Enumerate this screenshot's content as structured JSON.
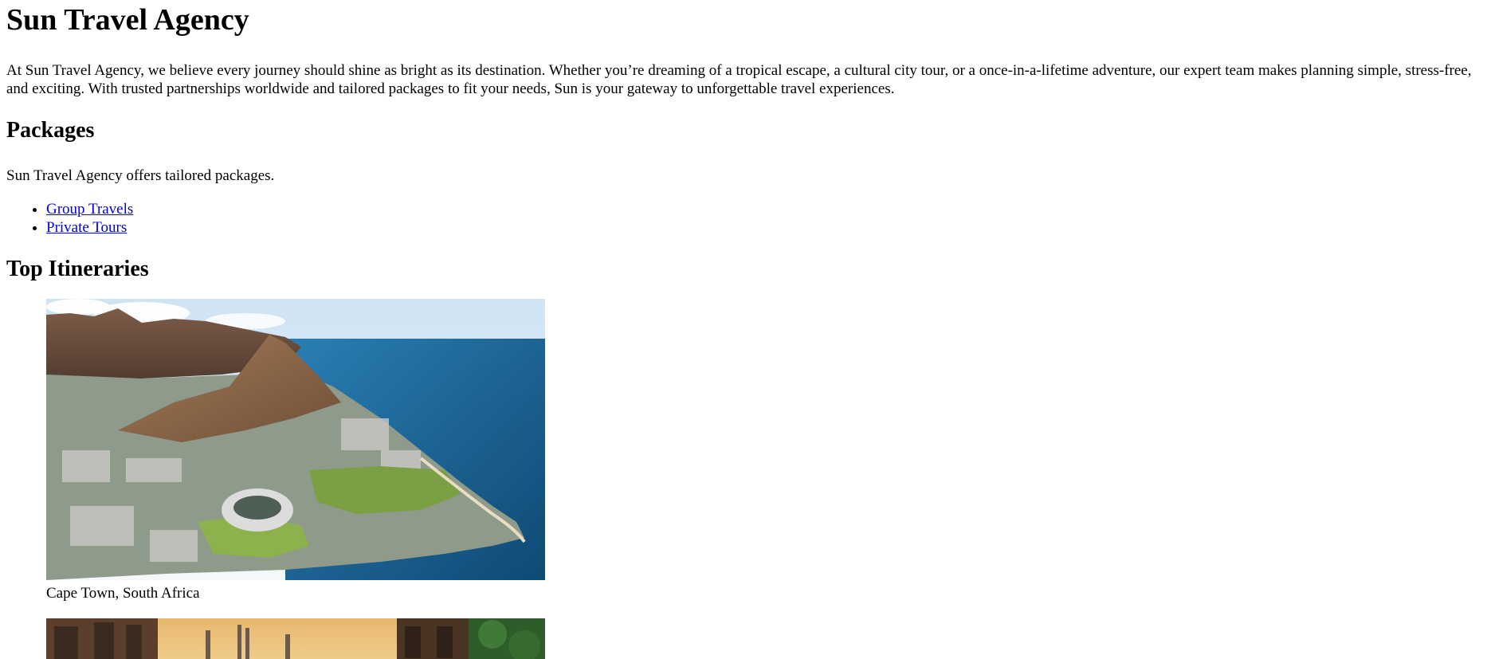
{
  "header": {
    "title": "Sun Travel Agency",
    "intro": "At Sun Travel Agency, we believe every journey should shine as bright as its destination. Whether you’re dreaming of a tropical escape, a cultural city tour, or a once-in-a-lifetime adventure, our expert team makes planning simple, stress-free, and exciting. With trusted partnerships worldwide and tailored packages to fit your needs, Sun is your gateway to unforgettable travel experiences."
  },
  "packages": {
    "heading": "Packages",
    "text": "Sun Travel Agency offers tailored packages.",
    "links": [
      {
        "label": "Group Travels"
      },
      {
        "label": "Private Tours"
      }
    ]
  },
  "itineraries": {
    "heading": "Top Itineraries",
    "items": [
      {
        "caption": "Cape Town, South Africa"
      },
      {
        "caption": ""
      }
    ]
  }
}
